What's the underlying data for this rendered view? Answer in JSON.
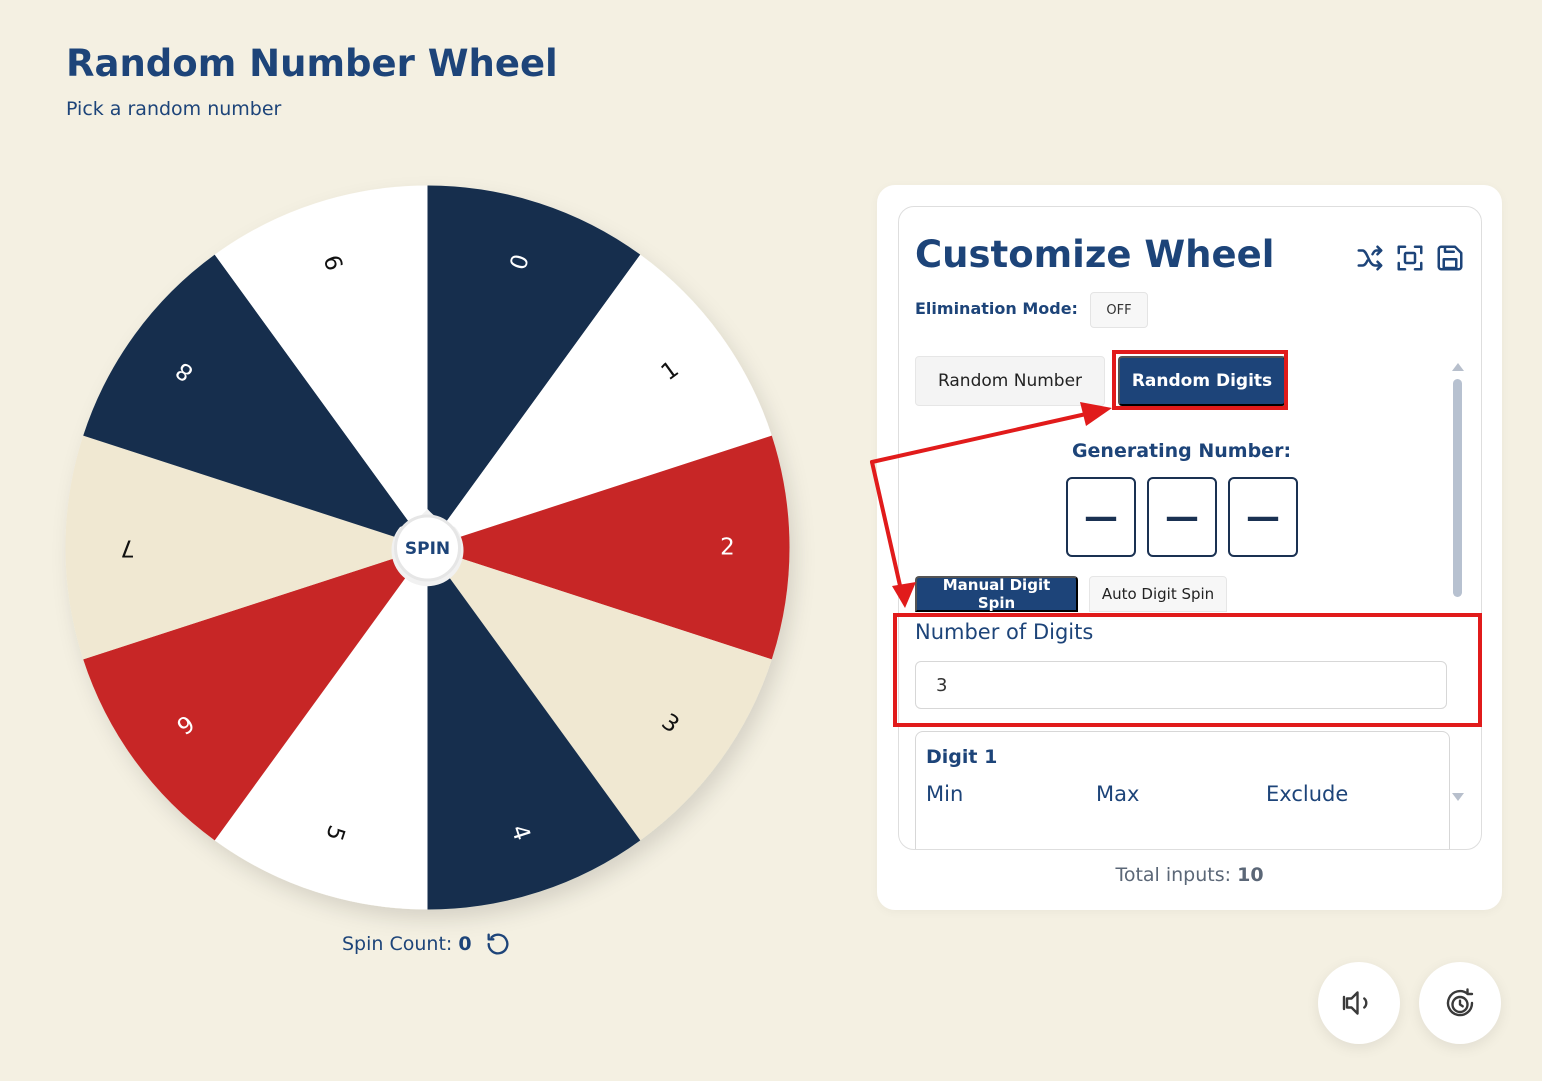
{
  "page": {
    "title": "Random Number Wheel",
    "subtitle": "Pick a random number"
  },
  "wheel": {
    "center_label": "SPIN",
    "segments": [
      {
        "label": "0",
        "color": "#132d4e"
      },
      {
        "label": "1",
        "color": "#ffffff"
      },
      {
        "label": "2",
        "color": "#c72627"
      },
      {
        "label": "3",
        "color": "#f0e8d2"
      },
      {
        "label": "4",
        "color": "#132d4e"
      },
      {
        "label": "5",
        "color": "#ffffff"
      },
      {
        "label": "6",
        "color": "#c72627"
      },
      {
        "label": "7",
        "color": "#f0e8d2"
      },
      {
        "label": "8",
        "color": "#132d4e"
      },
      {
        "label": "9",
        "color": "#ffffff"
      }
    ],
    "spin_count_label": "Spin Count:",
    "spin_count_value": "0"
  },
  "panel": {
    "title": "Customize Wheel",
    "elimination_label": "Elimination Mode:",
    "elimination_value": "OFF",
    "tabs": {
      "random_number": "Random Number",
      "random_digits": "Random Digits"
    },
    "generating_label": "Generating Number:",
    "digit_boxes": [
      "—",
      "—",
      "—"
    ],
    "sub_tabs": {
      "manual": "Manual Digit Spin",
      "auto": "Auto Digit Spin"
    },
    "number_of_digits_label": "Number of Digits",
    "number_of_digits_value": "3",
    "digit_card": {
      "title": "Digit 1",
      "min_label": "Min",
      "max_label": "Max",
      "exclude_label": "Exclude"
    },
    "total_inputs_label": "Total inputs:",
    "total_inputs_value": "10"
  },
  "icons": {
    "shuffle": "shuffle-icon",
    "fullscreen": "fullscreen-icon",
    "save": "save-icon",
    "reset": "reset-icon",
    "sound": "sound-icon",
    "history": "history-icon"
  },
  "colors": {
    "primary": "#1d4479",
    "highlight": "#e11b1b",
    "background": "#f4f0e2"
  }
}
